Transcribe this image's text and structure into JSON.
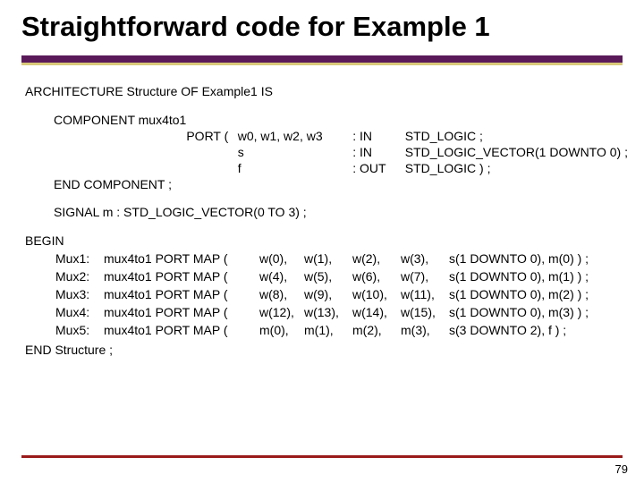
{
  "title": "Straightforward code for Example 1",
  "arch_line": "ARCHITECTURE Structure OF Example1 IS",
  "component_label": "COMPONENT mux4to1",
  "port_label": "PORT (",
  "port_rows": [
    {
      "sig": "w0, w1, w2, w3",
      "dir": ": IN",
      "type": "STD_LOGIC ;"
    },
    {
      "sig": "s",
      "dir": ": IN",
      "type": "STD_LOGIC_VECTOR(1 DOWNTO 0) ;"
    },
    {
      "sig": "f",
      "dir": ": OUT",
      "type": "STD_LOGIC ) ;"
    }
  ],
  "end_component": "END COMPONENT ;",
  "signal_line": "SIGNAL m : STD_LOGIC_VECTOR(0 TO 3) ;",
  "begin": "BEGIN",
  "map_rows": [
    {
      "label": "Mux1:",
      "inst": "mux4to1 PORT MAP (",
      "a": "w(0),",
      "b": "w(1),",
      "c": "w(2),",
      "d": "w(3),",
      "rest": "s(1 DOWNTO 0), m(0) ) ;"
    },
    {
      "label": "Mux2:",
      "inst": "mux4to1 PORT MAP (",
      "a": "w(4),",
      "b": "w(5),",
      "c": "w(6),",
      "d": "w(7),",
      "rest": "s(1 DOWNTO 0), m(1) ) ;"
    },
    {
      "label": "Mux3:",
      "inst": "mux4to1 PORT MAP (",
      "a": "w(8),",
      "b": "w(9),",
      "c": "w(10),",
      "d": "w(11),",
      "rest": "s(1 DOWNTO 0), m(2) ) ;"
    },
    {
      "label": "Mux4:",
      "inst": "mux4to1 PORT MAP (",
      "a": "w(12),",
      "b": "w(13),",
      "c": "w(14),",
      "d": "w(15),",
      "rest": "s(1 DOWNTO 0), m(3) ) ;"
    },
    {
      "label": "Mux5:",
      "inst": "mux4to1 PORT MAP (",
      "a": "m(0),",
      "b": "m(1),",
      "c": "m(2),",
      "d": "m(3),",
      "rest": " s(3 DOWNTO 2),   f   ) ;"
    }
  ],
  "end_structure": "END Structure ;",
  "page_number": "79"
}
